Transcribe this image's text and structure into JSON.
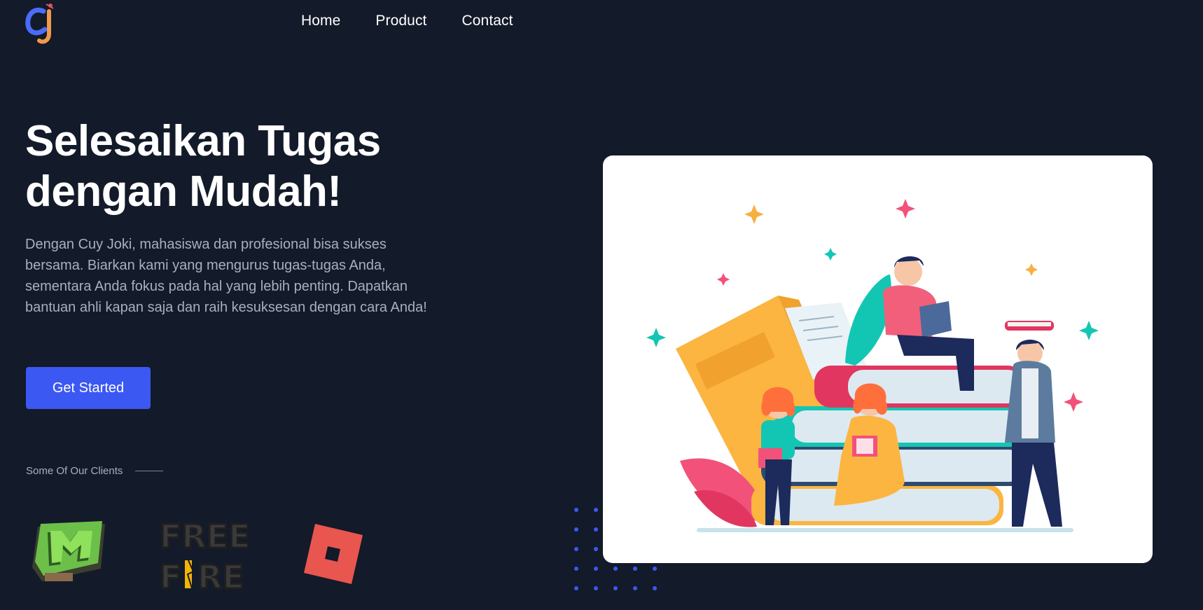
{
  "header": {
    "logo_icon": "cj-logo-icon",
    "nav": [
      {
        "label": "Home"
      },
      {
        "label": "Product"
      },
      {
        "label": "Contact"
      }
    ]
  },
  "hero": {
    "title_line1": "Selesaikan Tugas",
    "title_line2": "dengan Mudah!",
    "description": "Dengan Cuy Joki, mahasiswa dan profesional bisa sukses bersama. Biarkan kami yang mengurus tugas-tugas Anda, sementara Anda fokus pada hal yang lebih penting. Dapatkan bantuan ahli kapan saja dan raih kesuksesan dengan cara Anda!",
    "cta_label": "Get Started",
    "illustration_icon": "students-with-books-illustration"
  },
  "clients": {
    "label": "Some Of Our Clients",
    "logos": [
      {
        "name": "minecraft-logo",
        "text": "M"
      },
      {
        "name": "free-fire-logo",
        "text": "FREE FIRE"
      },
      {
        "name": "roblox-logo"
      }
    ]
  },
  "colors": {
    "background": "#131a29",
    "accent": "#3c58f2",
    "muted_text": "#a8afbe"
  }
}
